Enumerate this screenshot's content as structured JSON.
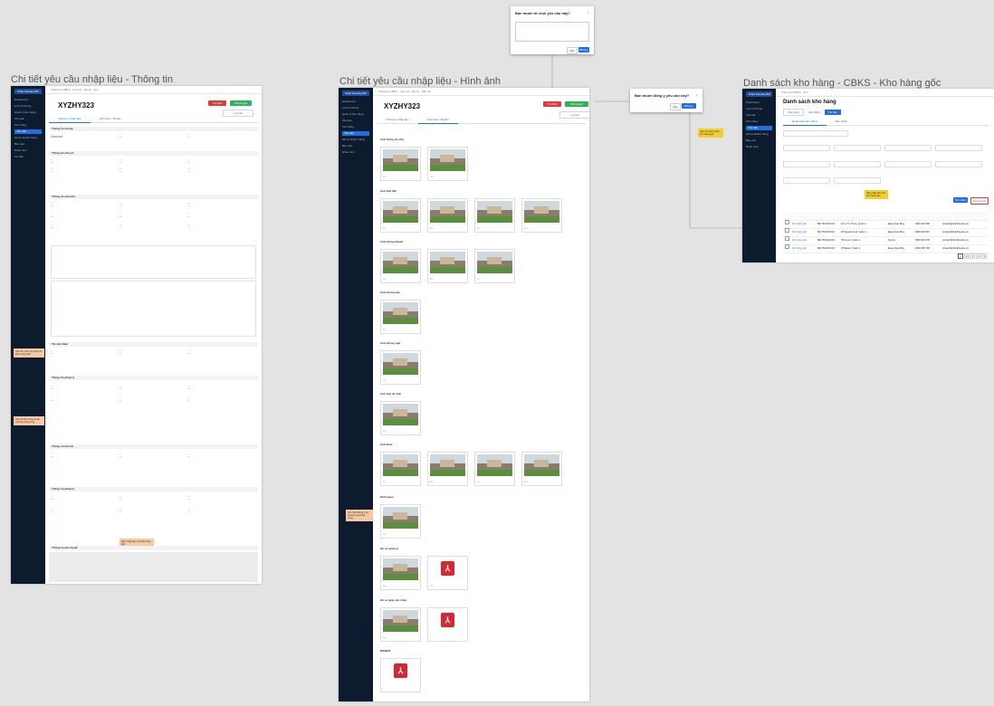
{
  "frames": {
    "info": {
      "title": "Chi tiết yêu cầu nhập liệu - Thông tin"
    },
    "images": {
      "title": "Chi tiết yêu cầu nhập liệu - Hình ảnh"
    },
    "warehouse": {
      "title": "Danh sách kho hàng - CBKS - Kho hàng gốc"
    }
  },
  "app": {
    "brand": "Chief Housing BO",
    "sidebar_items": [
      "Dashboard",
      "Lịch sử thông",
      "Quản lý kho hàng",
      "Kết quả",
      "Kho hàng",
      "Yêu cầu",
      "Hồ sơ khách hàng",
      "Báo cáo",
      "Nhân viên",
      "Cài đặt"
    ],
    "tabs": [
      "Thông tin CBKS",
      "Lịch sử",
      "Hồ sơ",
      "Kho",
      "Tiến độ"
    ]
  },
  "request": {
    "code": "XYZHY323",
    "reject_label": "Từ chối",
    "approve_label": "Phê duyệt",
    "save_label": "Lưu lại",
    "tab_info": "Thông tin nhập liệu",
    "tab_images": "Hình ảnh / Tài liệu",
    "sections": [
      "Thông tin chung",
      "Thông tin chủ sở",
      "Thông tin căn nhà",
      "Tài sản khác",
      "Thông tin pháp lý",
      "Thông tin liên hệ",
      "Thông tin pháp lý",
      "Thông tin phê duyệt"
    ]
  },
  "images_page": {
    "groups": [
      "Ảnh thông tin nhà",
      "Ảnh mặt tiền",
      "Ảnh phòng khách",
      "Ảnh phòng bếp",
      "Ảnh phòng ngủ",
      "Ảnh nhà vệ sinh",
      "Ảnh khác",
      "Hình quan",
      "Hồ sơ pháp lý",
      "Hồ sơ giấy xác nhận",
      "DN/BĐS"
    ],
    "pdf_label": "PDF"
  },
  "dialogs": {
    "reject": {
      "title": "Bạn muốn từ chối yêu cầu này?",
      "cancel": "Hủy",
      "confirm": "Đồng ý"
    },
    "approve": {
      "title": "Bạn muốn đồng ý yêu cầu này?",
      "cancel": "Hủy",
      "confirm": "Đồng ý"
    }
  },
  "warehouse": {
    "title": "Danh sách kho hàng",
    "subtabs": [
      "Kho hàng",
      "Hợp đồng",
      "Tài liệu"
    ],
    "filter_tabs": [
      "Danh sách kho hàng",
      "Sản phẩm"
    ],
    "search_label": "Tìm kiếm",
    "clear_label": "Xóa bộ lọc",
    "pagination": [
      "1",
      "2",
      "3",
      "4",
      "5"
    ],
    "rows": [
      {
        "name": "Kho hàng gốc",
        "code": "BĐ-TPHCM-001",
        "address": "12 Lý Tự Trọng, Quận 1",
        "status": "Đang hoạt động",
        "phone": "0903 123 456",
        "email": "contact@chiefhousing.vn"
      },
      {
        "name": "Kho hàng gốc",
        "code": "BĐ-TPHCM-002",
        "address": "45 Nguyễn Huệ, Quận 1",
        "status": "Đang hoạt động",
        "phone": "0903 234 567",
        "email": "contact@chiefhousing.vn"
      },
      {
        "name": "Kho hàng gốc",
        "code": "BĐ-TPHCM-003",
        "address": "78 Lê Lợi, Quận 1",
        "status": "Ngưng",
        "phone": "0903 345 678",
        "email": "contact@chiefhousing.vn"
      },
      {
        "name": "Kho hàng gốc",
        "code": "BĐ-TPHCM-004",
        "address": "9 Pasteur, Quận 3",
        "status": "Đang hoạt động",
        "phone": "0903 456 789",
        "email": "contact@chiefhousing.vn"
      }
    ]
  },
  "notes": {
    "n1": "Ghi chú: hiển thị thông tin theo trạng thái",
    "n2": "Nếu dữ liệu trống sẽ ẩn trường tương ứng",
    "n3": "Khi nhấn Đồng ý sẽ chuyển sang kho hàng",
    "n4": "Nếu nhập liệu cho kho hàng gốc",
    "n5": "Hiển thị danh sách kho hàng gốc"
  }
}
